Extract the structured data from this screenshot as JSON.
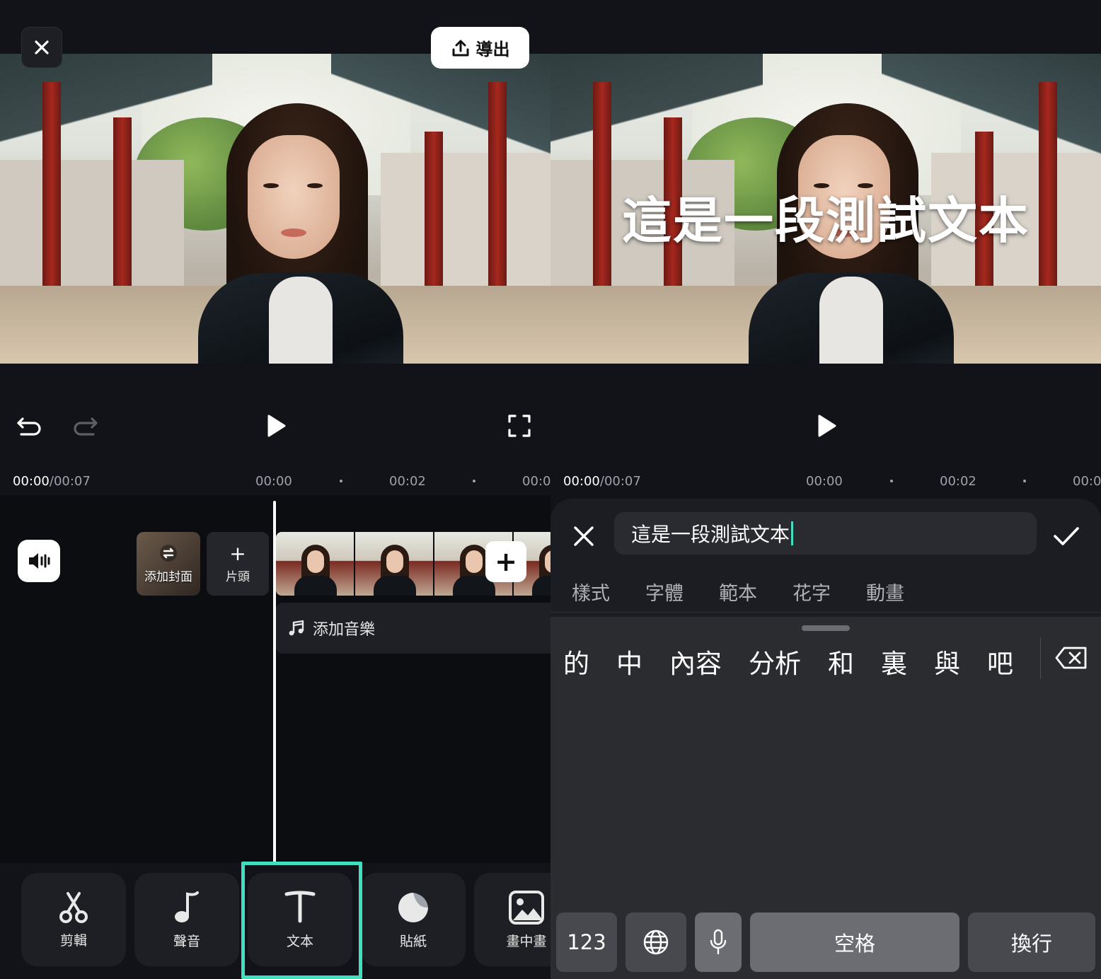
{
  "left": {
    "export_label": "導出",
    "time": {
      "current": "00:00",
      "total": "/00:07",
      "ticks": [
        "00:00",
        "00:02",
        "00:0"
      ]
    },
    "timeline": {
      "cover_label": "添加封面",
      "intro_label": "片頭",
      "music_label": "添加音樂"
    },
    "tools": [
      {
        "label": "剪輯",
        "icon": "scissors-icon"
      },
      {
        "label": "聲音",
        "icon": "music-note-icon"
      },
      {
        "label": "文本",
        "icon": "text-icon",
        "selected": true
      },
      {
        "label": "貼紙",
        "icon": "sticker-icon"
      },
      {
        "label": "畫中畫",
        "icon": "picture-in-picture-icon"
      }
    ]
  },
  "right": {
    "overlay_text": "這是一段測試文本",
    "time": {
      "current": "00:00",
      "total": "/00:07",
      "ticks": [
        "00:00",
        "00:02",
        "00:0"
      ]
    },
    "editor": {
      "input_value": "這是一段測試文本",
      "tabs": [
        "樣式",
        "字體",
        "範本",
        "花字",
        "動畫"
      ]
    },
    "keyboard": {
      "candidates": [
        "的",
        "中",
        "內容",
        "分析",
        "和",
        "裏",
        "與",
        "吧"
      ],
      "keys": [
        "123",
        "空格",
        "換行"
      ]
    }
  },
  "colors": {
    "accent": "#3ee0bf",
    "background": "#121318"
  }
}
